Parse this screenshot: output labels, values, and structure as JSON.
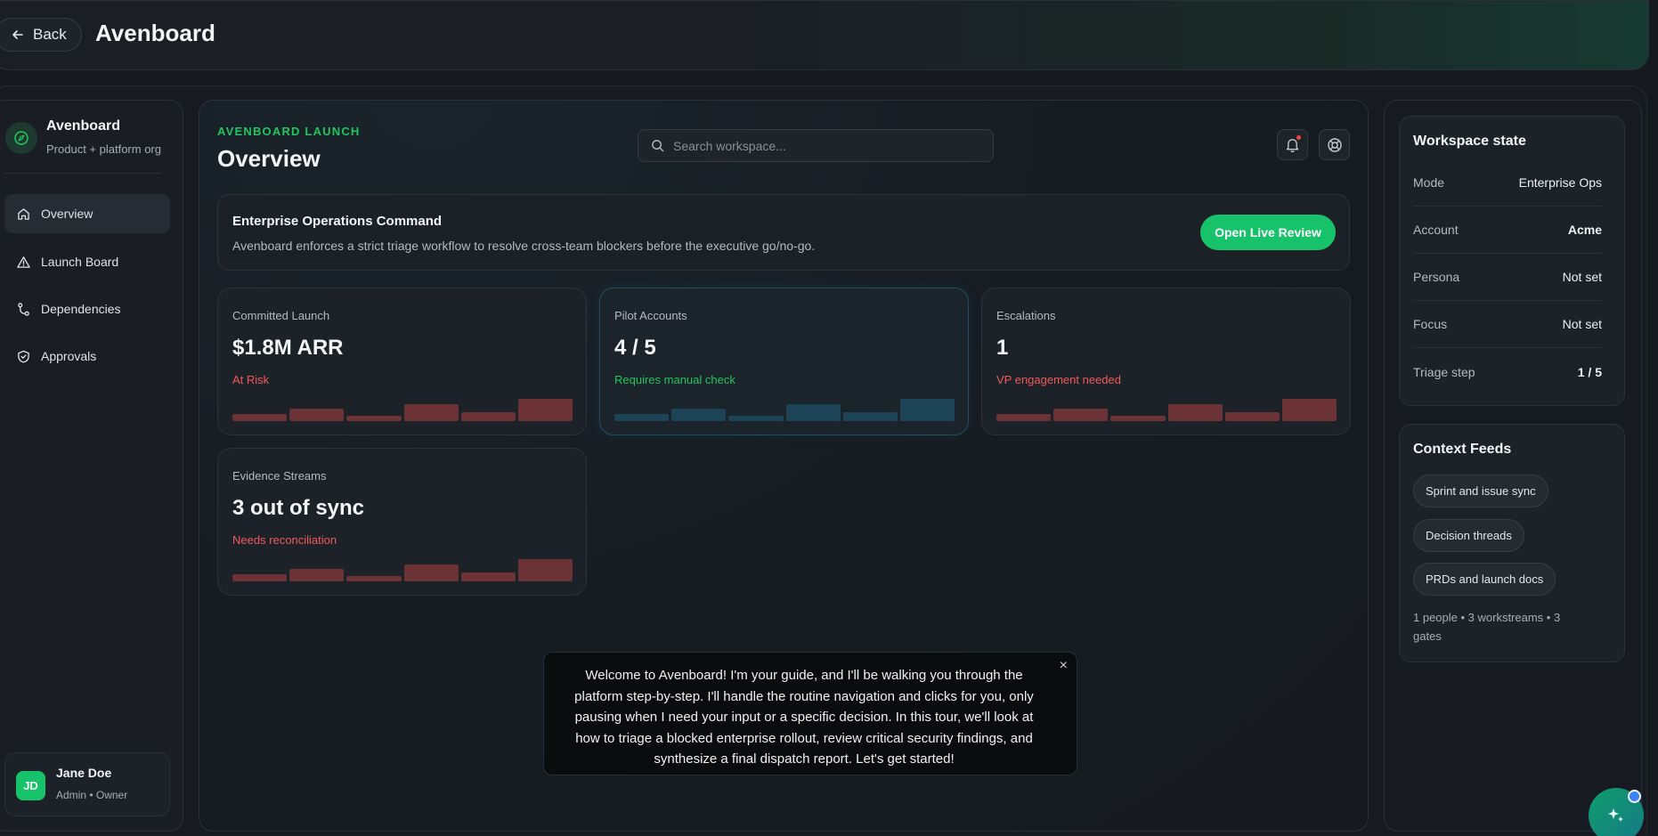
{
  "header": {
    "back_label": "Back",
    "app_title": "Avenboard"
  },
  "sidebar": {
    "brand_name": "Avenboard",
    "brand_sub": "Product + platform org",
    "items": [
      {
        "label": "Overview",
        "icon": "home-icon",
        "active": true
      },
      {
        "label": "Launch Board",
        "icon": "warning-triangle-icon",
        "active": false
      },
      {
        "label": "Dependencies",
        "icon": "branch-icon",
        "active": false
      },
      {
        "label": "Approvals",
        "icon": "shield-icon",
        "active": false
      }
    ],
    "user": {
      "initials": "JD",
      "name": "Jane Doe",
      "role": "Admin • Owner"
    }
  },
  "main": {
    "eyebrow": "AVENBOARD LAUNCH",
    "title": "Overview",
    "search_placeholder": "Search workspace...",
    "banner": {
      "title": "Enterprise Operations Command",
      "description": "Avenboard enforces a strict triage workflow to resolve cross-team blockers before the executive go/no-go.",
      "cta": "Open Live Review"
    },
    "cards": [
      {
        "label": "Committed Launch",
        "value": "$1.8M ARR",
        "status": "At Risk",
        "tone": "red",
        "spark": [
          0.3,
          0.55,
          0.25,
          0.75,
          0.4,
          0.95
        ]
      },
      {
        "label": "Pilot Accounts",
        "value": "4 / 5",
        "status": "Requires manual check",
        "tone": "green",
        "spark": [
          0.3,
          0.55,
          0.25,
          0.75,
          0.4,
          0.95
        ]
      },
      {
        "label": "Escalations",
        "value": "1",
        "status": "VP engagement needed",
        "tone": "red",
        "spark": [
          0.3,
          0.55,
          0.25,
          0.75,
          0.4,
          0.95
        ]
      },
      {
        "label": "Evidence Streams",
        "value": "3 out of sync",
        "status": "Needs reconciliation",
        "tone": "red",
        "spark": [
          0.3,
          0.55,
          0.25,
          0.75,
          0.4,
          0.95
        ]
      }
    ],
    "tour": {
      "text": "Welcome to Avenboard! I'm your guide, and I'll be walking you through the platform step-by-step. I'll handle the routine navigation and clicks for you, only pausing when I need your input or a specific decision. In this tour, we'll look at how to triage a blocked enterprise rollout, review critical security findings, and synthesize a final dispatch report. Let's get started!",
      "close": "×"
    }
  },
  "right": {
    "state_title": "Workspace state",
    "state": [
      {
        "key": "Mode",
        "value": "Enterprise Ops",
        "bold": false
      },
      {
        "key": "Account",
        "value": "Acme",
        "bold": true
      },
      {
        "key": "Persona",
        "value": "Not set",
        "bold": false
      },
      {
        "key": "Focus",
        "value": "Not set",
        "bold": false
      },
      {
        "key": "Triage step",
        "value": "1 / 5",
        "bold": true
      }
    ],
    "feeds_title": "Context Feeds",
    "feeds": [
      "Sprint and issue sync",
      "Decision threads",
      "PRDs and launch docs"
    ],
    "feeds_meta": "1 people • 3 workstreams • 3 gates"
  },
  "colors": {
    "accent": "#16c26a",
    "danger": "#ef5a5a",
    "info": "#1d4356"
  }
}
